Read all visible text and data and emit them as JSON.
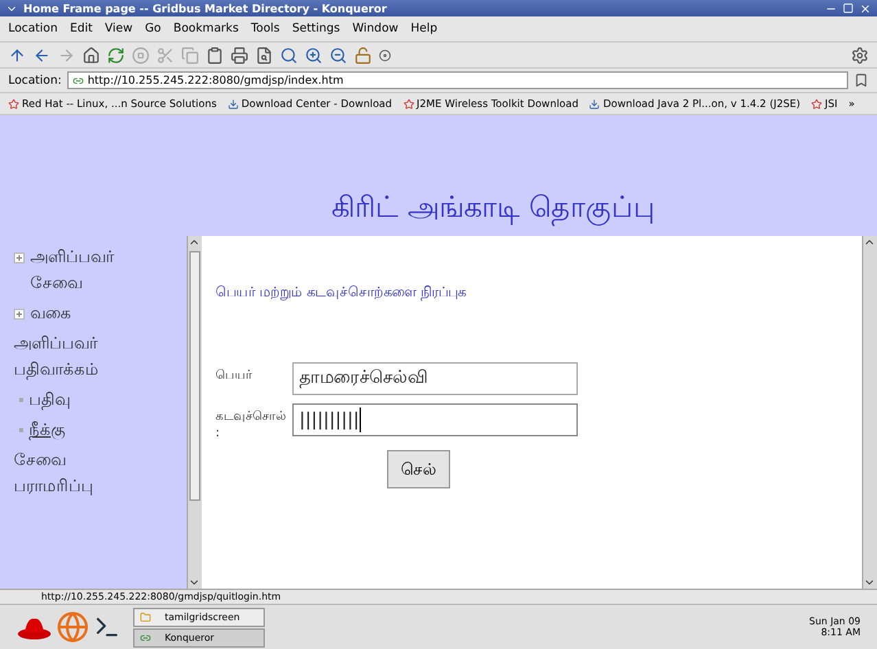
{
  "window": {
    "title": "Home Frame page -- Gridbus Market Directory - Konqueror"
  },
  "menu_bar": [
    "Location",
    "Edit",
    "View",
    "Go",
    "Bookmarks",
    "Tools",
    "Settings",
    "Window",
    "Help"
  ],
  "location_bar": {
    "label": "Location:",
    "value": "http://10.255.245.222:8080/gmdjsp/index.htm"
  },
  "bookmarks": [
    {
      "label": "Red Hat -- Linux, ...n Source Solutions"
    },
    {
      "label": "Download Center - Download"
    },
    {
      "label": "J2ME Wireless Toolkit Download"
    },
    {
      "label": "Download Java 2 Pl...on, v 1.4.2 (J2SE)"
    },
    {
      "label": "JSI"
    }
  ],
  "bookmarks_more": "»",
  "page": {
    "heading": "கிரிட் அங்காடி தொகுப்பு",
    "sidebar": {
      "items": [
        {
          "kind": "node",
          "label": "அளிப்பவர் சேவை",
          "expanded": false
        },
        {
          "kind": "node",
          "label": "வகை",
          "expanded": false
        },
        {
          "kind": "group",
          "label": "அளிப்பவர் பதிவாக்கம்",
          "children": [
            {
              "label": "பதிவு",
              "hovered": false
            },
            {
              "label": "நீக்கு",
              "hovered": true
            }
          ]
        },
        {
          "kind": "group",
          "label": "சேவை பராமரிப்பு"
        }
      ]
    },
    "form": {
      "instruction": "பெயர் மற்றும் கடவுச்சொற்களை நிரப்புக",
      "fields": [
        {
          "label": "பெயர்",
          "value": "தாமரைச்செல்வி",
          "focused": false
        },
        {
          "label": "கடவுச்சொல் :",
          "value": "||||||||||",
          "focused": true
        }
      ],
      "submit": "செல்"
    }
  },
  "status_bar": "http://10.255.245.222:8080/gmdjsp/quitlogin.htm",
  "taskbar": {
    "tasks": [
      {
        "label": "tamilgridscreen",
        "selected": false
      },
      {
        "label": "Konqueror",
        "selected": true
      }
    ],
    "date": "Sun Jan 09",
    "time": "8:11 AM"
  }
}
